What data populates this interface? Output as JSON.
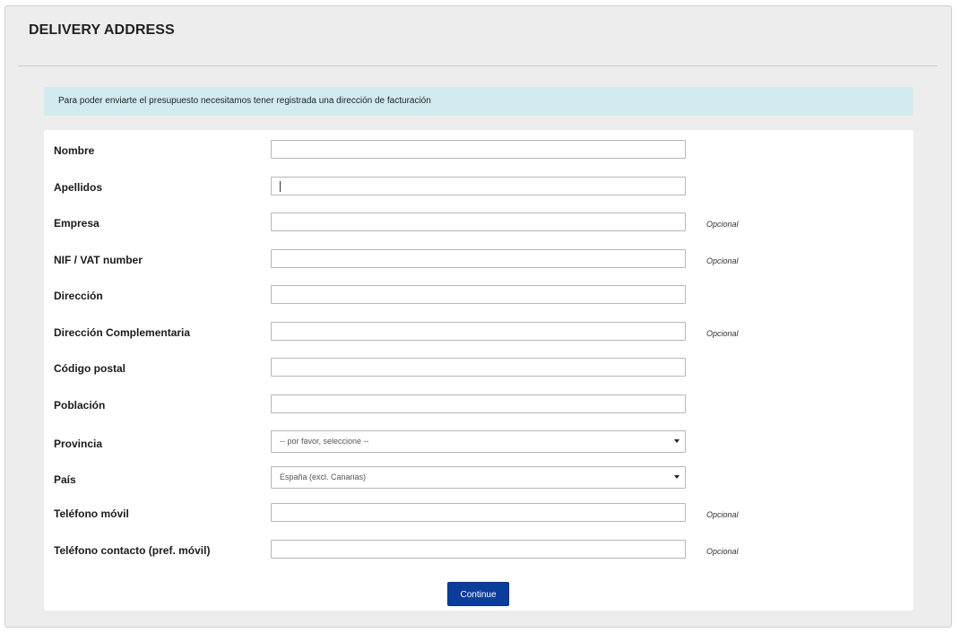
{
  "header": {
    "title": "DELIVERY ADDRESS"
  },
  "alert": {
    "text": "Para poder enviarte el presupuesto necesitamos tener registrada una dirección de facturación"
  },
  "form": {
    "optional_label": "Opcional",
    "fields": [
      {
        "label": "Nombre",
        "value": ""
      },
      {
        "label": "Apellidos",
        "value": ""
      },
      {
        "label": "Empresa",
        "value": ""
      },
      {
        "label": "NIF / VAT number",
        "value": ""
      },
      {
        "label": "Dirección",
        "value": ""
      },
      {
        "label": "Dirección Complementaria",
        "value": ""
      },
      {
        "label": "Código postal",
        "value": ""
      },
      {
        "label": "Población",
        "value": ""
      },
      {
        "label": "Provincia",
        "selected": "-- por favor, seleccione --"
      },
      {
        "label": "País",
        "selected": "España (excl. Canarias)"
      },
      {
        "label": "Teléfono móvil",
        "value": ""
      },
      {
        "label": "Teléfono contacto (pref. móvil)",
        "value": ""
      }
    ],
    "continue_label": "Continue"
  },
  "colors": {
    "panel_bg": "#ededed",
    "alert_bg": "#d2ebf0",
    "button_bg": "#0b3d9b"
  }
}
